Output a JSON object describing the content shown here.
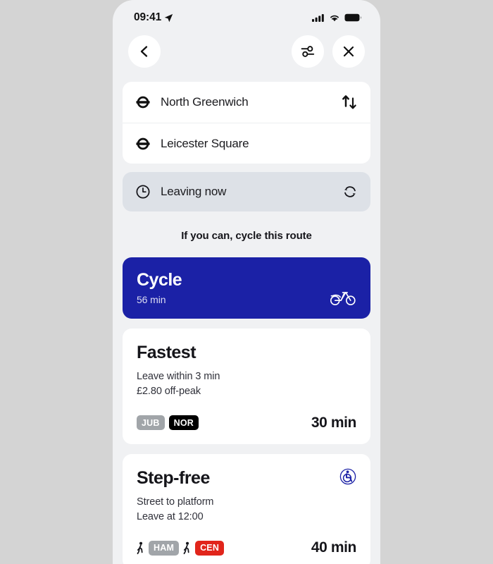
{
  "status_bar": {
    "time": "09:41",
    "location_icon": "location-arrow-icon",
    "signal_icon": "cellular-signal-icon",
    "wifi_icon": "wifi-icon",
    "battery_icon": "battery-full-icon"
  },
  "header": {
    "back_icon": "chevron-left-icon",
    "filter_icon": "filter-sliders-icon",
    "close_icon": "close-x-icon"
  },
  "journey": {
    "from": {
      "label": "North Greenwich",
      "icon": "tfl-roundel-icon"
    },
    "to": {
      "label": "Leicester Square",
      "icon": "tfl-roundel-icon"
    },
    "swap_icon": "swap-arrows-icon",
    "time_option": {
      "label": "Leaving now",
      "clock_icon": "clock-icon",
      "refresh_icon": "refresh-icon"
    }
  },
  "promo": {
    "text": "If you can, cycle this route"
  },
  "routes": [
    {
      "title": "Cycle",
      "duration": "56 min",
      "icon": "bicycle-icon",
      "background": "#1b21a6",
      "highlight": true
    },
    {
      "title": "Fastest",
      "lines": [
        "Leave within 3 min",
        "£2.80 off-peak"
      ],
      "duration": "30 min",
      "legs": [
        {
          "code": "JUB",
          "color": "#a1a5a9"
        },
        {
          "code": "NOR",
          "color": "#000000"
        }
      ]
    },
    {
      "title": "Step-free",
      "lines": [
        "Street to platform",
        "Leave at 12:00"
      ],
      "duration": "40 min",
      "accessibility_icon": "wheelchair-accessible-icon",
      "legs": [
        {
          "code": "HAM",
          "color": "#a1a5a9"
        },
        {
          "code": "CEN",
          "color": "#e1251b"
        }
      ]
    }
  ],
  "colors": {
    "backdrop": "#d4d4d4",
    "screen": "#f0f1f3",
    "card": "#ffffff",
    "cycle_blue": "#1b21a6",
    "leaving_bar": "#dde1e7",
    "text": "#15151a",
    "accessible_blue": "#1b21a6"
  }
}
